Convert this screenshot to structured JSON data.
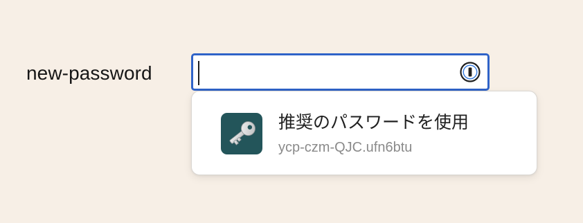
{
  "form": {
    "field_label": "new-password",
    "field_value": ""
  },
  "password_manager": {
    "field_icon": "1password-icon",
    "suggestion": {
      "icon": "key-icon",
      "title": "推奨のパスワードを使用",
      "generated_password": "ycp-czm-QJC.ufn6btu"
    }
  },
  "colors": {
    "background": "#f7efe6",
    "focus_ring": "#2f63c8",
    "key_tile": "#23555a",
    "secondary_text": "#8a8a8a"
  }
}
